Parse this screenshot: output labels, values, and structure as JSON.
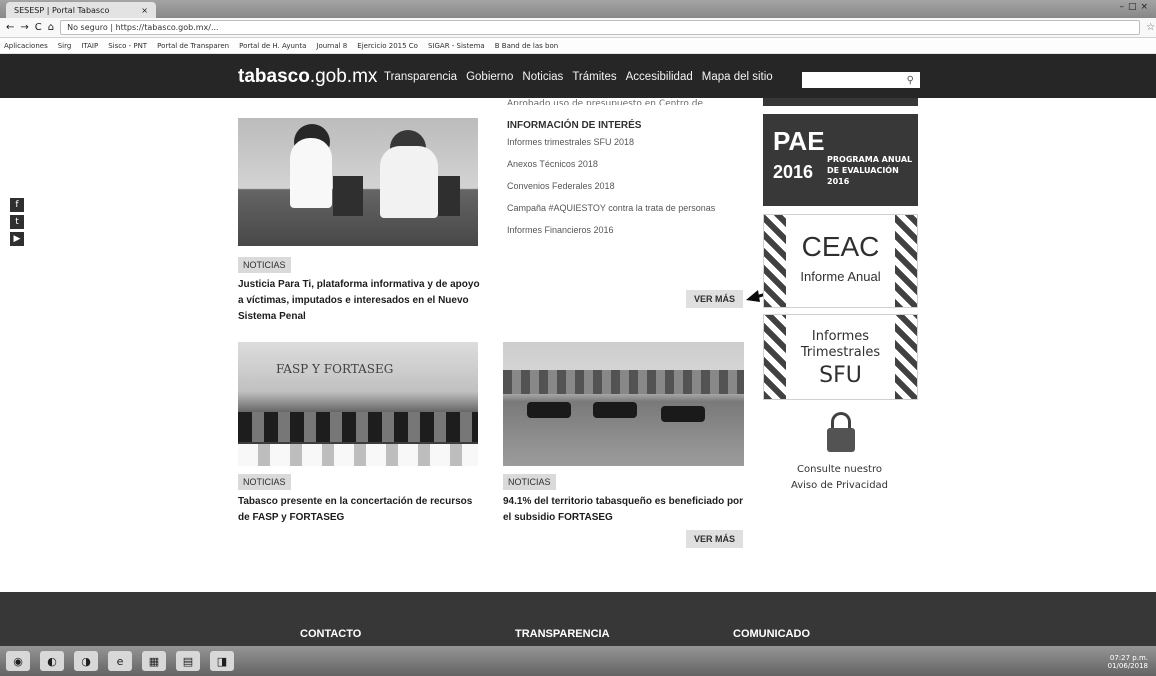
{
  "browser": {
    "tab_title": "SESESP | Portal Tabasco",
    "tab_close": "×",
    "window_controls": [
      "–",
      "□",
      "×"
    ],
    "nav_buttons": [
      "←",
      "→",
      "C",
      "⌂"
    ],
    "url": "No seguro | https://tabasco.gob.mx/...",
    "star": "☆",
    "bookmarks": [
      "Aplicaciones",
      "Sirg",
      "ITAIP",
      "Sisco - PNT",
      "Portal de Transparen",
      "Portal de H. Ayunta",
      "Journal 8",
      "Ejercicio 2015 Co",
      "SIGAR - Sistema",
      "B Band de las bon"
    ]
  },
  "site": {
    "logo_main": "tabasco",
    "logo_suffix": ".gob.mx",
    "nav": [
      "Transparencia",
      "Gobierno",
      "Noticias",
      "Trámites",
      "Accesibilidad",
      "Mapa del sitio"
    ],
    "search_icon": "⚲"
  },
  "social": [
    "f",
    "t",
    "▶"
  ],
  "top_cut_text": "Aprobado uso de presupuesto en Centro de Estudios para la Eficiencia...",
  "info": {
    "title": "INFORMACIÓN DE INTERÉS",
    "links": [
      "Informes trimestrales SFU 2018",
      "Anexos Técnicos 2018",
      "Convenios Federales 2018",
      "Campaña #AQUIESTOY contra la trata de personas",
      "Informes Financieros 2016"
    ],
    "button": "VER MÁS"
  },
  "news": [
    {
      "tag": "NOTICIAS",
      "headline": "Justicia Para Ti, plataforma informativa y de apoyo a víctimas, imputados e interesados en el Nuevo Sistema Penal"
    },
    {
      "tag": "NOTICIAS",
      "headline": "Tabasco presente en la concertación de recursos de FASP y FORTASEG",
      "photo_banner": "FASP Y FORTASEG"
    },
    {
      "tag": "NOTICIAS",
      "headline": "94.1% del territorio tabasqueño es beneficiado por el subsidio FORTASEG"
    }
  ],
  "news_button": "VER MÁS",
  "banners": {
    "pae_logo": "PAE",
    "pae_year": "2016",
    "pae_text": "PROGRAMA ANUAL DE EVALUACIÓN 2016",
    "ceac_title": "CEAC",
    "ceac_sub": "Informe Anual",
    "sfu_line1": "Informes",
    "sfu_line2": "Trimestrales",
    "sfu_line3": "SFU",
    "priv_line1": "Consulte nuestro",
    "priv_line2": "Aviso de Privacidad"
  },
  "footer": [
    "CONTACTO",
    "TRANSPARENCIA",
    "COMUNICADO"
  ],
  "taskbar": {
    "icons": [
      "◉",
      "◐",
      "◑",
      "e",
      "▦",
      "▤",
      "◨"
    ],
    "time": "07:27 p.m.",
    "date": "01/06/2018"
  }
}
